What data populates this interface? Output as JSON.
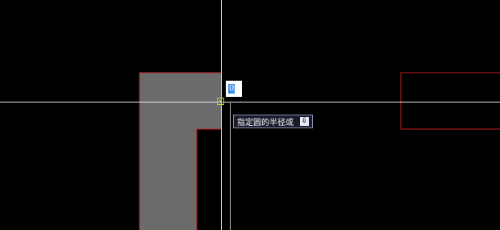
{
  "canvas": {
    "background": "#000000",
    "fill_color": "#6b6b6b",
    "outline_color": "#c81e1e"
  },
  "dynamic_input": {
    "value": "0"
  },
  "command_prompt": {
    "text": "指定圆的半径或",
    "options_icon": "down-arrow-icon"
  },
  "colors": {
    "crosshair": "#e8e8e8",
    "snap_marker": "#b4d63a",
    "prompt_bg": "#1a1c2e"
  }
}
